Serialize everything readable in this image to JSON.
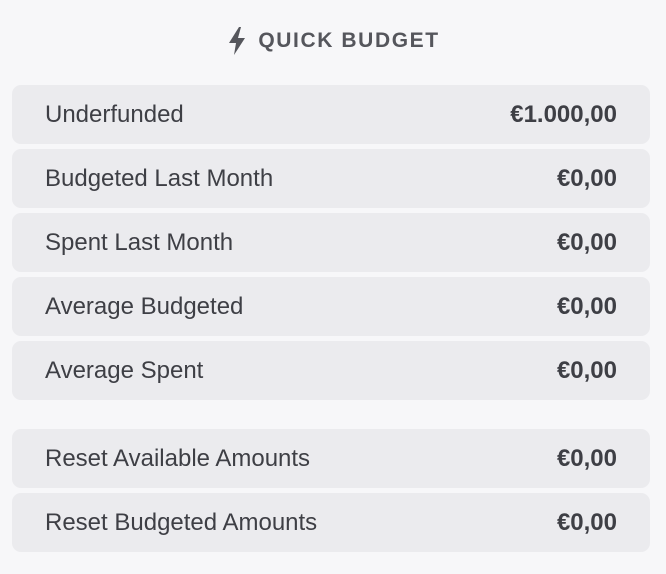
{
  "header": {
    "title": "QUICK BUDGET",
    "icon": "lightning-bolt-icon"
  },
  "groups": [
    {
      "rows": [
        {
          "label": "Underfunded",
          "value": "€1.000,00"
        },
        {
          "label": "Budgeted Last Month",
          "value": "€0,00"
        },
        {
          "label": "Spent Last Month",
          "value": "€0,00"
        },
        {
          "label": "Average Budgeted",
          "value": "€0,00"
        },
        {
          "label": "Average Spent",
          "value": "€0,00"
        }
      ]
    },
    {
      "rows": [
        {
          "label": "Reset Available Amounts",
          "value": "€0,00"
        },
        {
          "label": "Reset Budgeted Amounts",
          "value": "€0,00"
        }
      ]
    }
  ],
  "colors": {
    "background": "#f7f7f9",
    "row_background": "#ebebee",
    "text": "#3e3f45",
    "header_text": "#55565c"
  }
}
